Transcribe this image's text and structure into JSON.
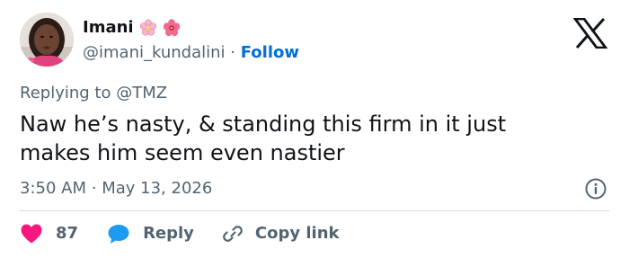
{
  "author": {
    "display_name": "Imani",
    "handle": "@imani_kundalini",
    "separator": "·",
    "follow_label": "Follow",
    "name_emojis": [
      "cherry-blossom-icon",
      "hibiscus-icon"
    ]
  },
  "reply_context": {
    "prefix": "Replying to",
    "target": "@TMZ"
  },
  "tweet": {
    "line1": "Naw he’s nasty, & standing this firm in it just",
    "line2": "makes him seem even nastier",
    "time": "3:50 AM",
    "separator": "·",
    "date": "May 13, 2026"
  },
  "actions": {
    "like_count": "87",
    "reply_label": "Reply",
    "copy_label": "Copy link"
  },
  "colors": {
    "like": "#f91880",
    "reply": "#1d9bf0",
    "link": "#006fd6",
    "secondary_text": "#536471",
    "primary_text": "#0f1419"
  }
}
